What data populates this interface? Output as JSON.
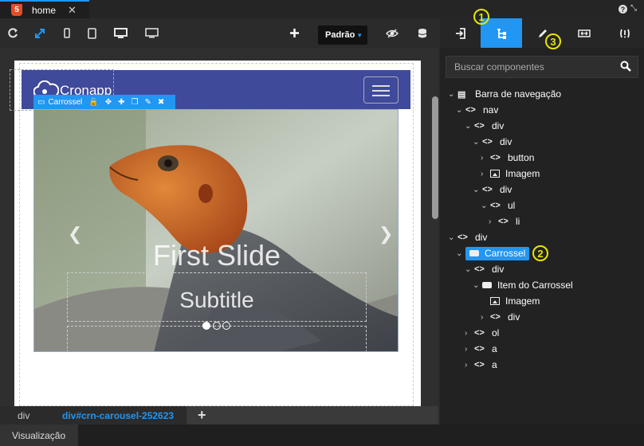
{
  "tabs": {
    "active_label": "home",
    "close_glyph": "✕"
  },
  "window": {
    "help_glyph": "?",
    "restore_glyph": "⤡"
  },
  "toolbar": {
    "icons": [
      "refresh-icon",
      "expand-icon",
      "phone-icon",
      "tablet-icon",
      "desktop-icon",
      "monitor-icon",
      "add-icon",
      "hide-icon",
      "database-icon"
    ],
    "device_select": "Padrão"
  },
  "canvas": {
    "logo_text": "Cronapp",
    "selection_tag": "Carrossel",
    "slide_title": "First Slide",
    "slide_subtitle": "Subtitle",
    "carousel_indicators": 3,
    "carousel_active_index": 0
  },
  "breadcrumb": {
    "items": [
      "div",
      "div#crn-carousel-252623"
    ],
    "add_glyph": "+"
  },
  "status": {
    "tab_label": "Visualização"
  },
  "panel": {
    "tabs": [
      "import-icon",
      "tree-icon",
      "edit-icon",
      "resize-icon",
      "code-icon"
    ],
    "active_tab_index": 1,
    "search_placeholder": "Buscar componentes",
    "tree": [
      {
        "label": "Barra de navegação",
        "icon": "navbar",
        "level": 0
      },
      {
        "label": "nav",
        "icon": "tag",
        "level": 1
      },
      {
        "label": "div",
        "icon": "tag",
        "level": 2
      },
      {
        "label": "div",
        "icon": "tag",
        "level": 3
      },
      {
        "label": "button",
        "icon": "tag",
        "level": 4
      },
      {
        "label": "Imagem",
        "icon": "image",
        "level": 4
      },
      {
        "label": "div",
        "icon": "tag",
        "level": 3
      },
      {
        "label": "ul",
        "icon": "tag",
        "level": 4
      },
      {
        "label": "li",
        "icon": "tag",
        "level": 5
      },
      {
        "label": "div",
        "icon": "tag",
        "level": 0
      },
      {
        "label": "Carrossel",
        "icon": "carousel",
        "level": 1,
        "selected": true
      },
      {
        "label": "div",
        "icon": "tag",
        "level": 2
      },
      {
        "label": "Item do Carrossel",
        "icon": "carousel",
        "level": 3
      },
      {
        "label": "Imagem",
        "icon": "image",
        "level": 4
      },
      {
        "label": "div",
        "icon": "tag",
        "level": 4
      },
      {
        "label": "ol",
        "icon": "tag",
        "level": 2
      },
      {
        "label": "a",
        "icon": "tag",
        "level": 2
      },
      {
        "label": "a",
        "icon": "tag",
        "level": 2
      }
    ]
  },
  "callouts": [
    "1",
    "2",
    "3"
  ],
  "colors": {
    "accent": "#2196f3",
    "navbar": "#3f4a9b",
    "callout": "#e6e600"
  }
}
